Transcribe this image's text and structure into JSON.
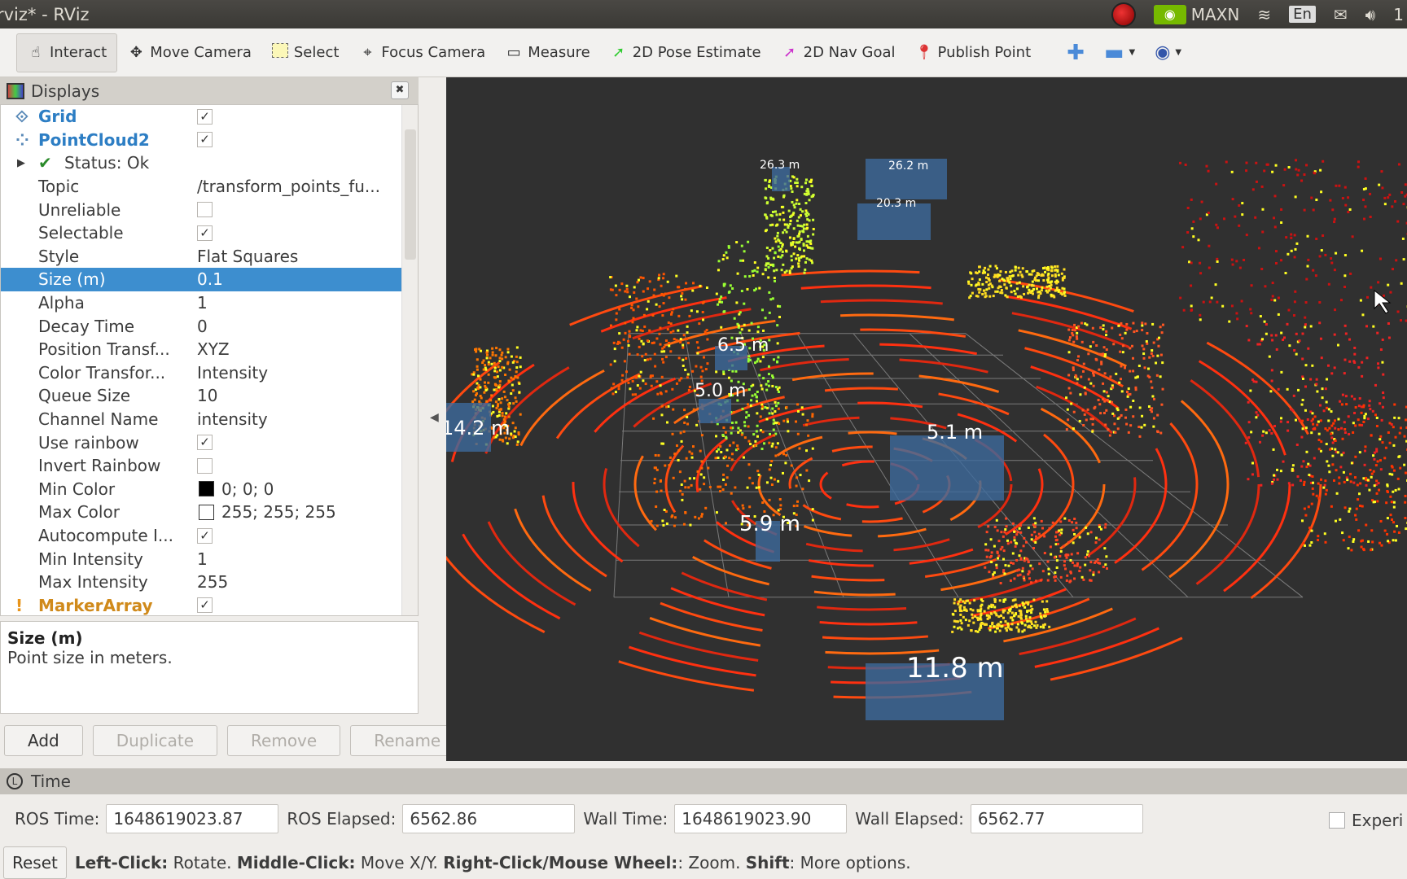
{
  "window": {
    "title": "rviz* - RViz"
  },
  "tray": {
    "power_mode": "MAXN",
    "lang": "En",
    "clock_partial": "1"
  },
  "toolbar": {
    "tools": [
      {
        "label": "Interact",
        "icon": "hand-pointer-icon",
        "active": true
      },
      {
        "label": "Move Camera",
        "icon": "move-camera-icon"
      },
      {
        "label": "Select",
        "icon": "select-box-icon"
      },
      {
        "label": "Focus Camera",
        "icon": "focus-target-icon"
      },
      {
        "label": "Measure",
        "icon": "ruler-icon"
      },
      {
        "label": "2D Pose Estimate",
        "icon": "green-arrow-icon"
      },
      {
        "label": "2D Nav Goal",
        "icon": "magenta-arrow-icon"
      },
      {
        "label": "Publish Point",
        "icon": "map-pin-icon"
      }
    ]
  },
  "displays": {
    "title": "Displays",
    "rows": [
      {
        "key": "Grid",
        "style": "blue",
        "check": true,
        "icon": "grid-icon"
      },
      {
        "key": "PointCloud2",
        "style": "blue",
        "check": true,
        "icon": "pointcloud-icon"
      },
      {
        "key": "Status: Ok",
        "status": true
      },
      {
        "key": "Topic",
        "value": "/transform_points_fu..."
      },
      {
        "key": "Unreliable",
        "check": false
      },
      {
        "key": "Selectable",
        "check": true
      },
      {
        "key": "Style",
        "value": "Flat Squares"
      },
      {
        "key": "Size (m)",
        "value": "0.1",
        "selected": true
      },
      {
        "key": "Alpha",
        "value": "1"
      },
      {
        "key": "Decay Time",
        "value": "0"
      },
      {
        "key": "Position Transf...",
        "value": "XYZ"
      },
      {
        "key": "Color Transfor...",
        "value": "Intensity"
      },
      {
        "key": "Queue Size",
        "value": "10"
      },
      {
        "key": "Channel Name",
        "value": "intensity"
      },
      {
        "key": "Use rainbow",
        "check": true
      },
      {
        "key": "Invert Rainbow",
        "check": false
      },
      {
        "key": "Min Color",
        "value": "0; 0; 0",
        "swatch": "#000000"
      },
      {
        "key": "Max Color",
        "value": "255; 255; 255",
        "swatch": "#ffffff"
      },
      {
        "key": "Autocompute I...",
        "check": true
      },
      {
        "key": "Min Intensity",
        "value": "1"
      },
      {
        "key": "Max Intensity",
        "value": "255"
      },
      {
        "key": "MarkerArray",
        "style": "orange",
        "check": true,
        "icon": "warning-icon"
      }
    ],
    "description": {
      "title": "Size (m)",
      "text": "Point size in meters."
    },
    "buttons": {
      "add": "Add",
      "duplicate": "Duplicate",
      "remove": "Remove",
      "rename": "Rename"
    }
  },
  "viewport": {
    "labels": [
      "26.3  m",
      "26.2  m",
      "20.3  m",
      "6.5  m",
      "5.0  m",
      "14.2  m",
      "5.1  m",
      "5.9  m",
      "11.8  m"
    ]
  },
  "time": {
    "title": "Time",
    "ros_time_label": "ROS Time:",
    "ros_time": "1648619023.87",
    "ros_elapsed_label": "ROS Elapsed:",
    "ros_elapsed": "6562.86",
    "wall_time_label": "Wall Time:",
    "wall_time": "1648619023.90",
    "wall_elapsed_label": "Wall Elapsed:",
    "wall_elapsed": "6562.77",
    "experimental_label": "Experi"
  },
  "status": {
    "reset": "Reset",
    "hints": [
      {
        "b": "Left-Click:",
        "t": " Rotate. "
      },
      {
        "b": "Middle-Click:",
        "t": " Move X/Y. "
      },
      {
        "b": "Right-Click/Mouse Wheel:",
        "t": ": Zoom. "
      },
      {
        "b": "Shift",
        "t": ": More options."
      }
    ]
  }
}
